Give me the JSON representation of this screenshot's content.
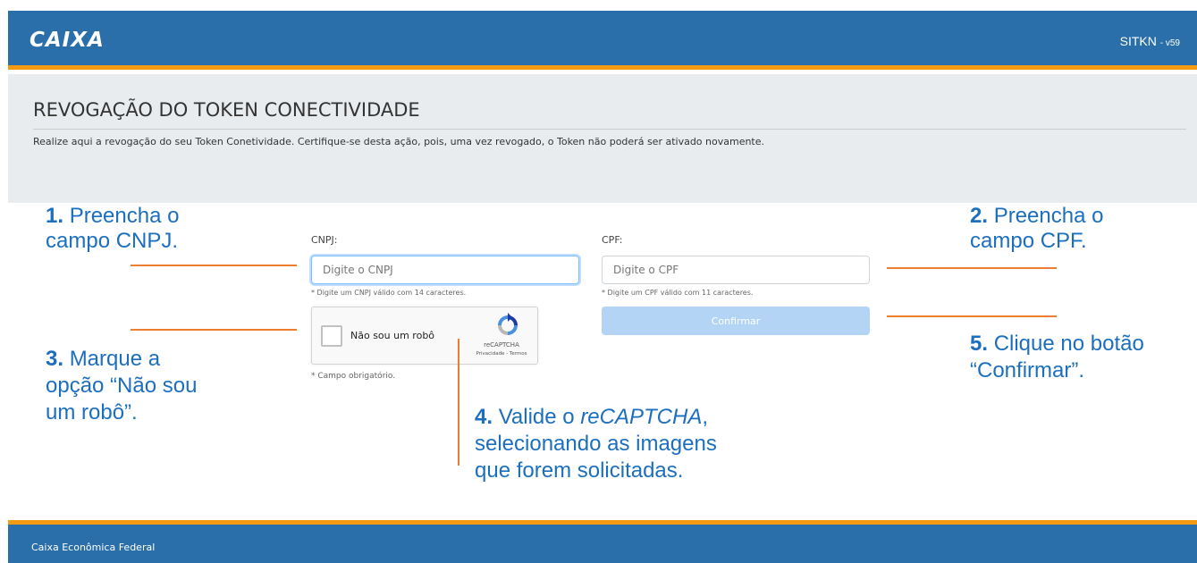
{
  "header": {
    "logo_text": "CAIXA",
    "system_name": "SITKN",
    "version": "- v59"
  },
  "banner": {
    "title": "REVOGAÇÃO DO TOKEN CONECTIVIDADE",
    "description": "Realize aqui a revogação do seu Token Conetividade. Certifique-se desta ação, pois, uma vez revogado, o Token não poderá ser ativado novamente."
  },
  "form": {
    "cnpj_label": "CNPJ:",
    "cnpj_placeholder": "Digite o CNPJ",
    "cnpj_hint": "* Digite um CNPJ válido com 14 caracteres.",
    "cpf_label": "CPF:",
    "cpf_placeholder": "Digite o CPF",
    "cpf_hint": "* Digite um CPF válido com 11 caracteres.",
    "required_note": "* Campo obrigatório.",
    "confirm_label": "Confirmar"
  },
  "captcha": {
    "label": "Não sou um robô",
    "brand": "reCAPTCHA",
    "links": "Privacidade - Termos"
  },
  "annotations": {
    "step1_num": "1.",
    "step1_line1": "Preencha o",
    "step1_line2": "campo CNPJ.",
    "step2_num": "2.",
    "step2_line1": "Preencha o",
    "step2_line2": "campo CPF.",
    "step3_num": "3.",
    "step3_line1": "Marque a",
    "step3_line2": "opção “Não sou",
    "step3_line3": "um robô”.",
    "step4_num": "4.",
    "step4_line1a": "Valide o",
    "step4_line1b": "reCAPTCHA",
    "step4_line1c": ",",
    "step4_line2": "selecionando as imagens",
    "step4_line3": "que forem solicitadas.",
    "step5_num": "5.",
    "step5_line1": "Clique no botão",
    "step5_line2": "“Confirmar”."
  },
  "footer": {
    "text": "Caixa Econômica Federal"
  },
  "colors": {
    "brand_blue": "#2a6fa9",
    "accent_orange": "#f39a12",
    "annotation_blue": "#1c6fbe",
    "callout_line": "#ed7d31",
    "button_disabled": "#b3d4f5"
  }
}
